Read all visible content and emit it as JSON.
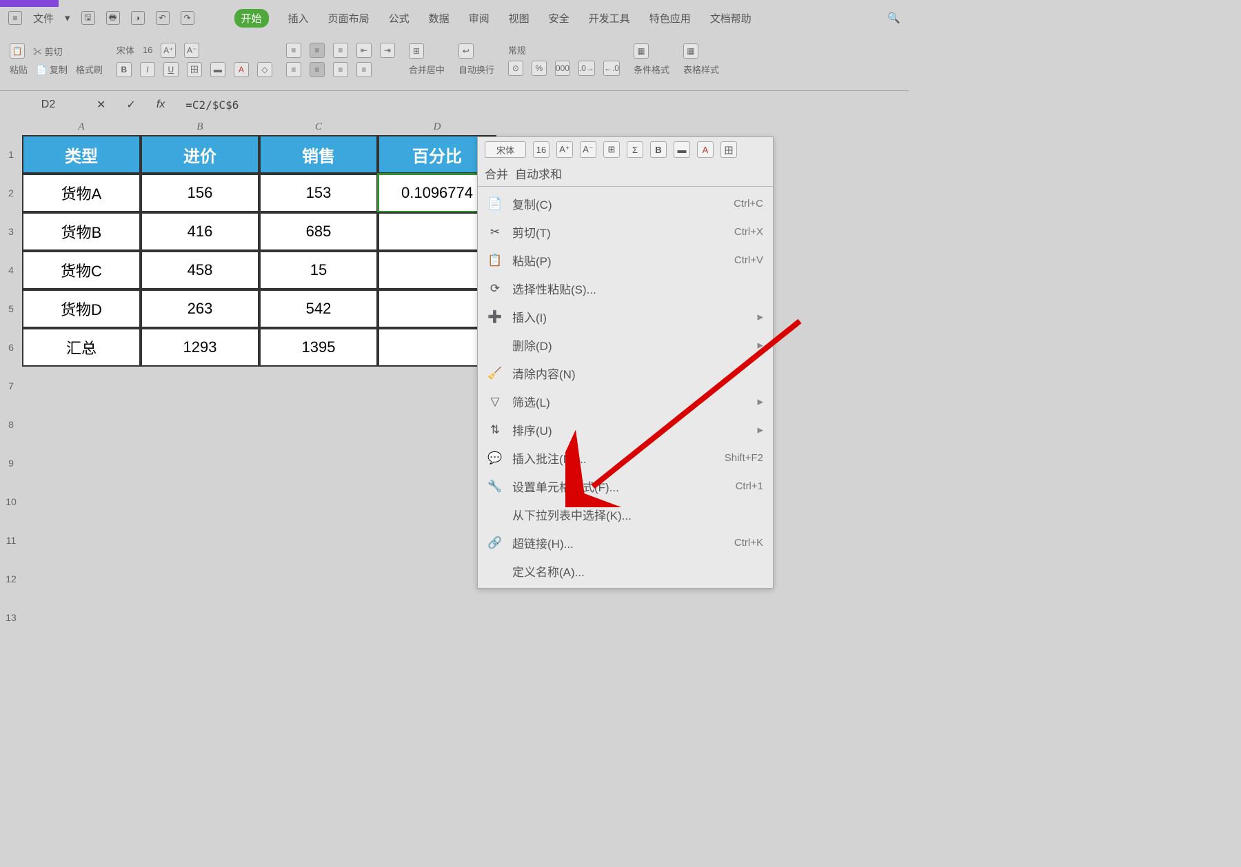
{
  "menu": {
    "file": "文件",
    "start": "开始",
    "insert": "插入",
    "layout": "页面布局",
    "formula": "公式",
    "data": "数据",
    "review": "审阅",
    "view": "视图",
    "safe": "安全",
    "dev": "开发工具",
    "special": "特色应用",
    "help": "文档帮助"
  },
  "ribbon": {
    "cut": "剪切",
    "paste": "粘贴",
    "copy": "复制",
    "fmtPainter": "格式刷",
    "font": "宋体",
    "size": "16",
    "merge": "合并居中",
    "wrap": "自动换行",
    "general": "常规",
    "condFmt": "条件格式",
    "tblStyle": "表格样式"
  },
  "fx": {
    "cellref": "D2",
    "formula": "=C2/$C$6"
  },
  "cols": [
    "A",
    "B",
    "C",
    "D"
  ],
  "rows": [
    "1",
    "2",
    "3",
    "4",
    "5",
    "6",
    "7",
    "8",
    "9",
    "10",
    "11",
    "12",
    "13"
  ],
  "table": {
    "headers": [
      "类型",
      "进价",
      "销售",
      "百分比"
    ],
    "data": [
      [
        "货物A",
        "156",
        "153",
        "0.1096774"
      ],
      [
        "货物B",
        "416",
        "685",
        ""
      ],
      [
        "货物C",
        "458",
        "15",
        ""
      ],
      [
        "货物D",
        "263",
        "542",
        ""
      ],
      [
        "汇总",
        "1293",
        "1395",
        ""
      ]
    ]
  },
  "miniToolbar": {
    "font": "宋体",
    "size": "16",
    "merge": "合并",
    "sum": "自动求和"
  },
  "ctx": {
    "copy": {
      "t": "复制(C)",
      "s": "Ctrl+C"
    },
    "cut": {
      "t": "剪切(T)",
      "s": "Ctrl+X"
    },
    "paste": {
      "t": "粘贴(P)",
      "s": "Ctrl+V"
    },
    "pasteSp": {
      "t": "选择性粘贴(S)..."
    },
    "insert": {
      "t": "插入(I)"
    },
    "delete": {
      "t": "删除(D)"
    },
    "clear": {
      "t": "清除内容(N)"
    },
    "filter": {
      "t": "筛选(L)"
    },
    "sort": {
      "t": "排序(U)"
    },
    "comment": {
      "t": "插入批注(M)...",
      "s": "Shift+F2"
    },
    "format": {
      "t": "设置单元格格式(F)...",
      "s": "Ctrl+1"
    },
    "pick": {
      "t": "从下拉列表中选择(K)..."
    },
    "link": {
      "t": "超链接(H)...",
      "s": "Ctrl+K"
    },
    "define": {
      "t": "定义名称(A)..."
    }
  }
}
